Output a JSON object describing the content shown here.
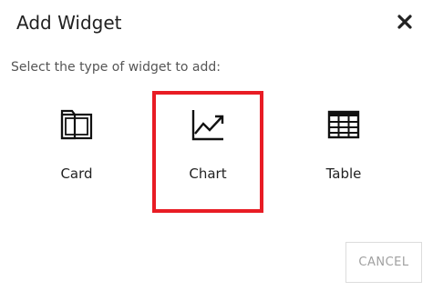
{
  "dialog": {
    "title": "Add Widget",
    "close_icon": "close-icon",
    "prompt": "Select the type of widget to add:",
    "options": [
      {
        "label": "Card",
        "icon": "folder-icon",
        "selected": false
      },
      {
        "label": "Chart",
        "icon": "line-chart-icon",
        "selected": true
      },
      {
        "label": "Table",
        "icon": "table-icon",
        "selected": false
      }
    ],
    "cancel_label": "CANCEL"
  },
  "colors": {
    "selection_border": "#e81c24",
    "text": "#222222",
    "muted_text": "#a0a0a0"
  }
}
